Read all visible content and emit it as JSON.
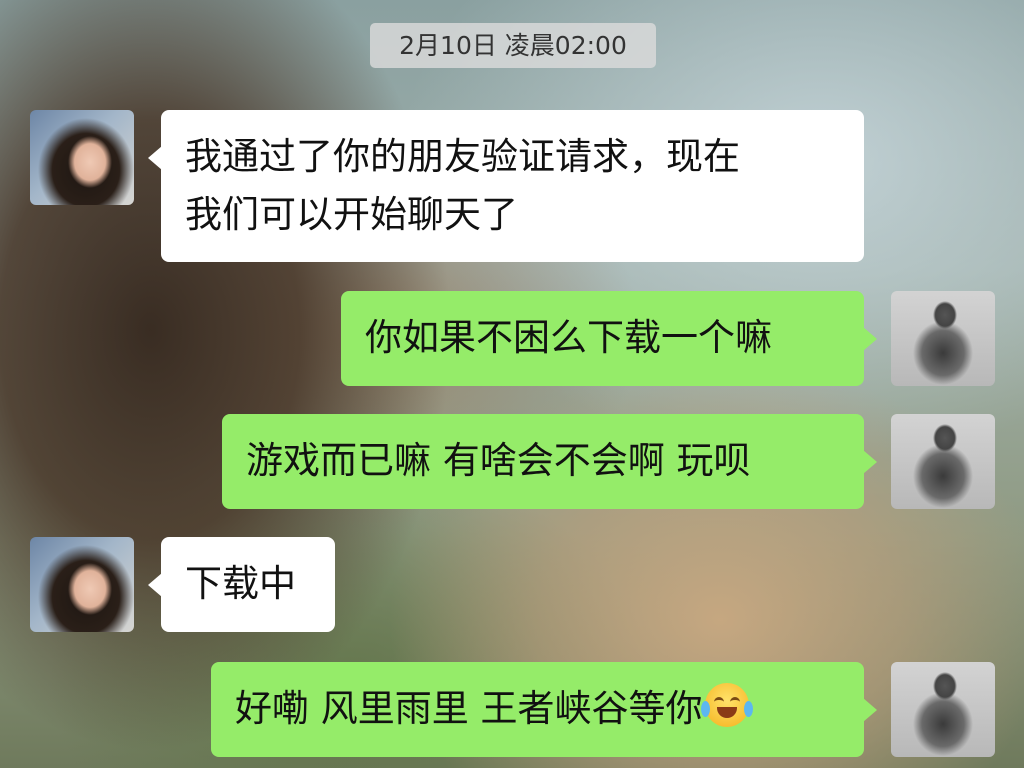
{
  "chat": {
    "timestamp": "2月10日 凌晨02:00",
    "messages": [
      {
        "side": "in",
        "avatar_icon": "girl-avatar",
        "lines": [
          "我通过了你的朋友验证请求，现在",
          "我们可以开始聊天了"
        ]
      },
      {
        "side": "out",
        "avatar_icon": "man-avatar",
        "lines": [
          "你如果不困么下载一个嘛"
        ]
      },
      {
        "side": "out",
        "avatar_icon": "man-avatar",
        "lines": [
          "游戏而已嘛  有啥会不会啊 玩呗"
        ]
      },
      {
        "side": "in",
        "avatar_icon": "girl-avatar",
        "lines": [
          "下载中"
        ]
      },
      {
        "side": "out",
        "avatar_icon": "man-avatar",
        "lines": [
          "好嘞  风里雨里 王者峡谷等你"
        ],
        "trailing_emoji": "tears-of-joy-emoji"
      }
    ]
  },
  "colors": {
    "incoming_bubble": "#ffffff",
    "outgoing_bubble": "#95ec69",
    "timestamp_bg": "#dadada"
  }
}
